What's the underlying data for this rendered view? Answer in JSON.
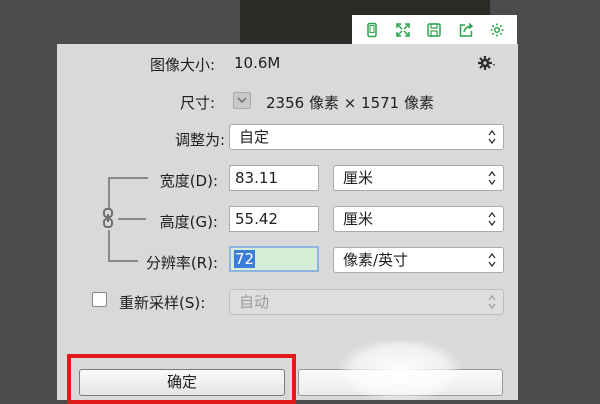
{
  "toolbar_icons": [
    "phone-icon",
    "expand-icon",
    "save-icon",
    "share-icon",
    "settings-icon"
  ],
  "dialog": {
    "image_size_label": "图像大小:",
    "image_size_value": "10.6M",
    "dimensions_label": "尺寸:",
    "dimensions_value": "2356 像素 × 1571 像素",
    "fit_to_label": "调整为:",
    "fit_to_value": "自定",
    "width_label": "宽度(D):",
    "width_value": "83.11",
    "width_unit": "厘米",
    "height_label": "高度(G):",
    "height_value": "55.42",
    "height_unit": "厘米",
    "resolution_label": "分辨率(R):",
    "resolution_value": "72",
    "resolution_unit": "像素/英寸",
    "resample_label": "重新采样(S):",
    "resample_checked": false,
    "resample_value": "自动",
    "ok_label": "确定",
    "cancel_label": ""
  },
  "colors": {
    "dialog_bg": "#d9d9d9",
    "highlight": "#e01a1a",
    "toolbar_icon": "#2aa44a",
    "selection": "#3b7dd8"
  }
}
